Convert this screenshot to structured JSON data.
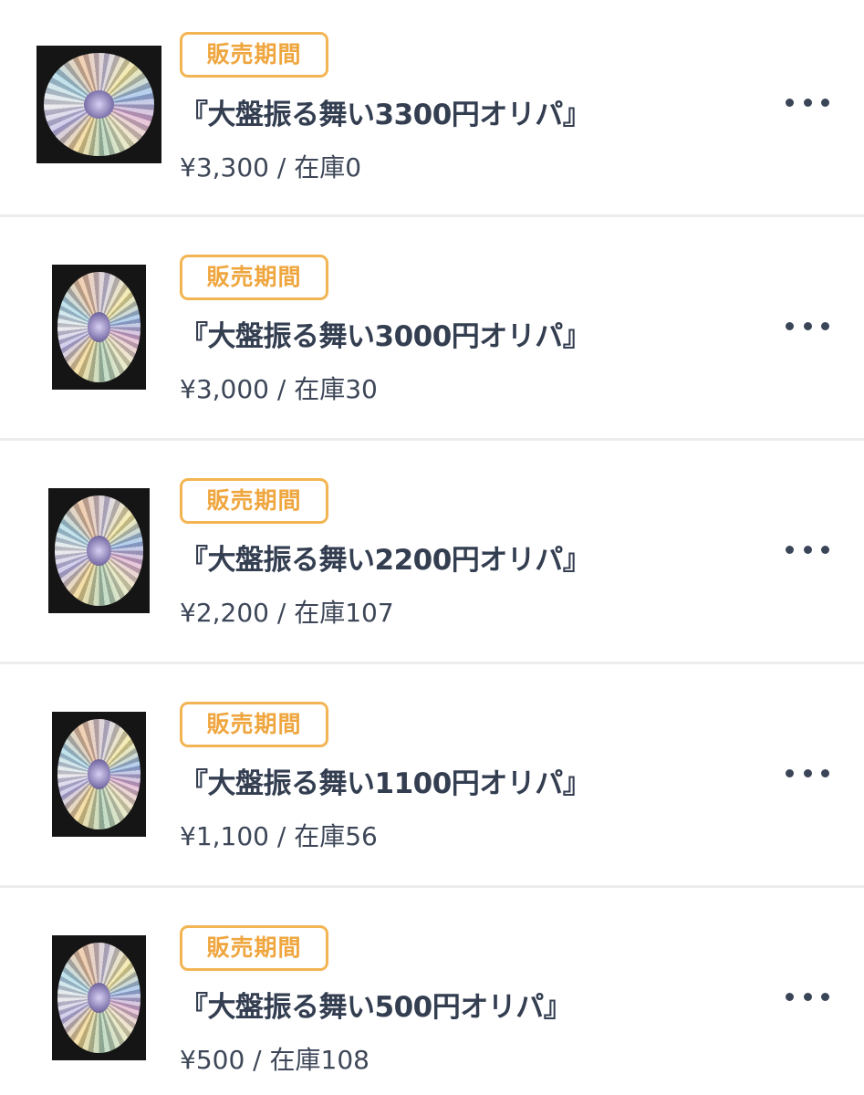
{
  "items": [
    {
      "badge": "販売期間",
      "title": "『大盤振る舞い3300円オリパ』",
      "price": "¥3,300",
      "separator": " / ",
      "stock": "在庫0",
      "more_icon": "more-horizontal-icon"
    },
    {
      "badge": "販売期間",
      "title": "『大盤振る舞い3000円オリパ』",
      "price": "¥3,000",
      "separator": " / ",
      "stock": "在庫30",
      "more_icon": "more-horizontal-icon"
    },
    {
      "badge": "販売期間",
      "title": "『大盤振る舞い2200円オリパ』",
      "price": "¥2,200",
      "separator": " / ",
      "stock": "在庫107",
      "more_icon": "more-horizontal-icon"
    },
    {
      "badge": "販売期間",
      "title": "『大盤振る舞い1100円オリパ』",
      "price": "¥1,100",
      "separator": " / ",
      "stock": "在庫56",
      "more_icon": "more-horizontal-icon"
    },
    {
      "badge": "販売期間",
      "title": "『大盤振る舞い500円オリパ』",
      "price": "¥500",
      "separator": " / ",
      "stock": "在庫108",
      "more_icon": "more-horizontal-icon"
    }
  ],
  "colors": {
    "badge_border": "#f3b553",
    "badge_text": "#efa63f",
    "title_text": "#343e51",
    "divider": "#ececec"
  }
}
